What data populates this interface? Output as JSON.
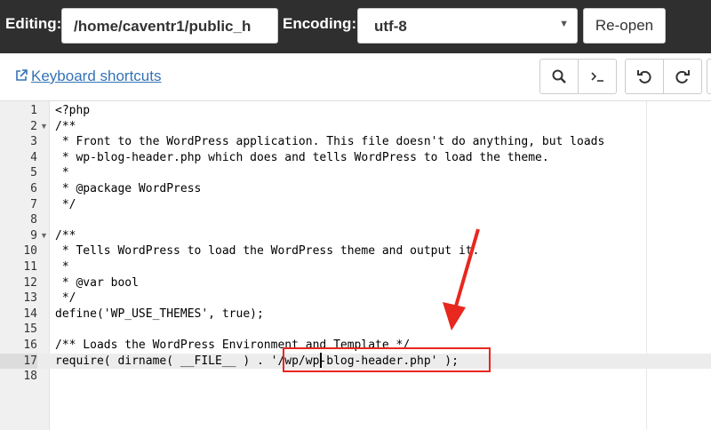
{
  "header": {
    "editing_label": "Editing:",
    "path_value": "/home/caventr1/public_h",
    "encoding_label": "Encoding:",
    "encoding_value": "utf-8",
    "reopen_label": "Re-open"
  },
  "toolbar": {
    "keyboard_shortcuts": "Keyboard shortcuts",
    "buttons": [
      "search-icon",
      "terminal-icon",
      "undo-icon",
      "redo-icon"
    ]
  },
  "editor": {
    "active_line": 17,
    "lines": [
      {
        "n": "1",
        "text": "<?php"
      },
      {
        "n": "2",
        "text": "/**",
        "fold": true
      },
      {
        "n": "3",
        "text": " * Front to the WordPress application. This file doesn't do anything, but loads"
      },
      {
        "n": "4",
        "text": " * wp-blog-header.php which does and tells WordPress to load the theme."
      },
      {
        "n": "5",
        "text": " *"
      },
      {
        "n": "6",
        "text": " * @package WordPress"
      },
      {
        "n": "7",
        "text": " */"
      },
      {
        "n": "8",
        "text": ""
      },
      {
        "n": "9",
        "text": "/**",
        "fold": true
      },
      {
        "n": "10",
        "text": " * Tells WordPress to load the WordPress theme and output it."
      },
      {
        "n": "11",
        "text": " *"
      },
      {
        "n": "12",
        "text": " * @var bool"
      },
      {
        "n": "13",
        "text": " */"
      },
      {
        "n": "14",
        "text": "define('WP_USE_THEMES', true);"
      },
      {
        "n": "15",
        "text": ""
      },
      {
        "n": "16",
        "text": "/** Loads the WordPress Environment and Template */"
      },
      {
        "n": "17",
        "text": "require( dirname( __FILE__ ) . '/wp/wp-blog-header.php' );"
      },
      {
        "n": "18",
        "text": ""
      }
    ]
  },
  "colors": {
    "topbar": "#2f2f30",
    "link": "#3473b6",
    "annotation": "#e8271e",
    "comment": "#236e24",
    "string": "#1a1aa6"
  }
}
